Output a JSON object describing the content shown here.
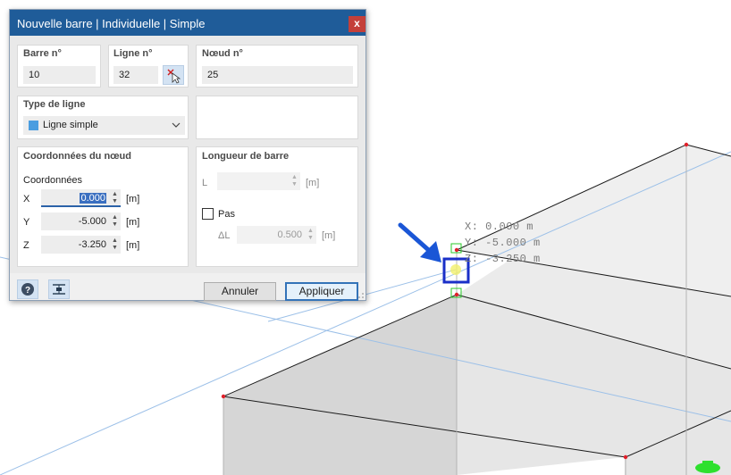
{
  "dialog": {
    "title": "Nouvelle barre | Individuelle | Simple",
    "close_glyph": "x",
    "member_no": {
      "label": "Barre n°",
      "value": "10"
    },
    "line_no": {
      "label": "Ligne n°",
      "value": "32",
      "pick_icon": "pick-line-icon"
    },
    "node_no": {
      "label": "Nœud n°",
      "value": "25"
    },
    "line_type": {
      "title": "Type de ligne",
      "selected": "Ligne simple",
      "swatch_color": "#4a9de0"
    },
    "node_coords": {
      "title": "Coordonnées du nœud",
      "subtitle": "Coordonnées",
      "x": {
        "label": "X",
        "value": "0.000",
        "unit": "[m]"
      },
      "y": {
        "label": "Y",
        "value": "-5.000",
        "unit": "[m]"
      },
      "z": {
        "label": "Z",
        "value": "-3.250",
        "unit": "[m]"
      }
    },
    "member_length": {
      "title": "Longueur de barre",
      "l_label": "L",
      "l_value": "",
      "l_unit": "[m]",
      "step_label": "Pas",
      "step_checked": false,
      "delta_label": "ΔL",
      "delta_value": "0.500",
      "delta_unit": "[m]"
    },
    "footer": {
      "help_icon": "help-icon",
      "snap_icon": "snap-node-icon",
      "cancel_label": "Annuler",
      "apply_label": "Appliquer"
    }
  },
  "viewport": {
    "readout_x": "X: 0.000 m",
    "readout_y": "Y: -5.000 m",
    "readout_z": "Z: -3.250 m",
    "arrow_color": "#1a56d6",
    "highlight_color": "#1a2fc8",
    "node_color": "#e0202a",
    "support_color": "#2ee02e"
  }
}
